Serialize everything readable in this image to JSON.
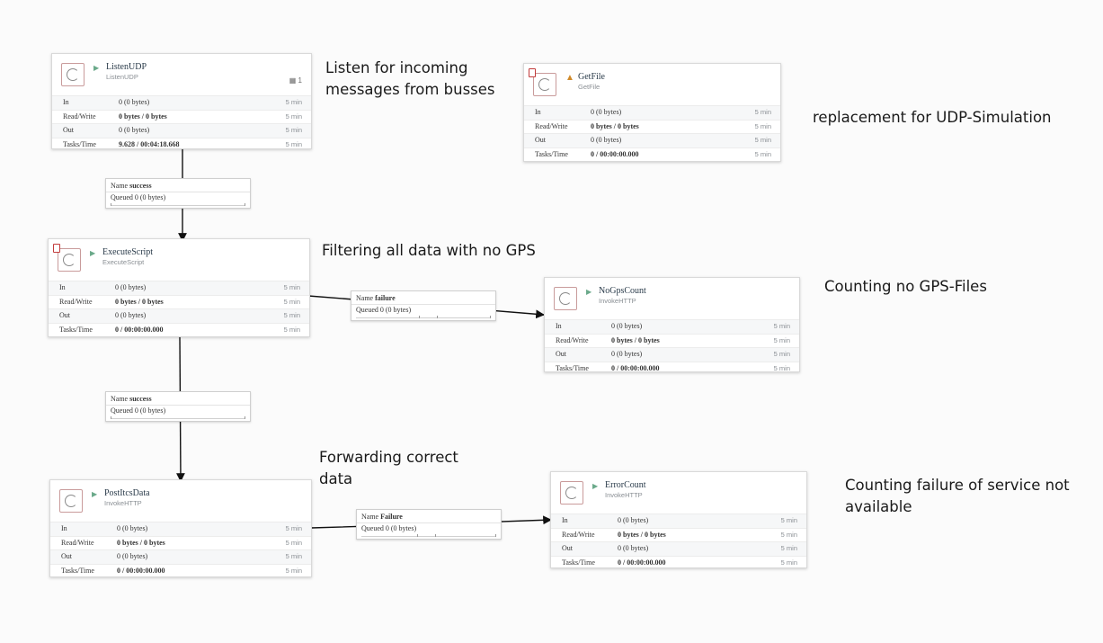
{
  "processors": [
    {
      "id": "listen-udp",
      "name": "ListenUDP",
      "type": "ListenUDP",
      "state": "run",
      "flag": false,
      "badge": "1",
      "stats": {
        "in": "0 (0 bytes)",
        "read_write": "0 bytes / 0 bytes",
        "out": "0 (0 bytes)",
        "tasks_time": "9.628 / 00:04:18.668"
      }
    },
    {
      "id": "get-file",
      "name": "GetFile",
      "type": "GetFile",
      "state": "warn",
      "flag": true,
      "badge": "",
      "stats": {
        "in": "0 (0 bytes)",
        "read_write": "0 bytes / 0 bytes",
        "out": "0 (0 bytes)",
        "tasks_time": "0 / 00:00:00.000"
      }
    },
    {
      "id": "execute-script",
      "name": "ExecuteScript",
      "type": "ExecuteScript",
      "state": "run",
      "flag": true,
      "badge": "",
      "stats": {
        "in": "0 (0 bytes)",
        "read_write": "0 bytes / 0 bytes",
        "out": "0 (0 bytes)",
        "tasks_time": "0 / 00:00:00.000"
      }
    },
    {
      "id": "no-gps-count",
      "name": "NoGpsCount",
      "type": "InvokeHTTP",
      "state": "run",
      "flag": false,
      "badge": "",
      "stats": {
        "in": "0 (0 bytes)",
        "read_write": "0 bytes / 0 bytes",
        "out": "0 (0 bytes)",
        "tasks_time": "0 / 00:00:00.000"
      }
    },
    {
      "id": "post-itcs-data",
      "name": "PostItcsData",
      "type": "InvokeHTTP",
      "state": "run",
      "flag": false,
      "badge": "",
      "stats": {
        "in": "0 (0 bytes)",
        "read_write": "0 bytes / 0 bytes",
        "out": "0 (0 bytes)",
        "tasks_time": "0 / 00:00:00.000"
      }
    },
    {
      "id": "error-count",
      "name": "ErrorCount",
      "type": "InvokeHTTP",
      "state": "run",
      "flag": false,
      "badge": "",
      "stats": {
        "in": "0 (0 bytes)",
        "read_write": "0 bytes / 0 bytes",
        "out": "0 (0 bytes)",
        "tasks_time": "0 / 00:00:00.000"
      }
    }
  ],
  "stat_labels": {
    "in": "In",
    "read_write": "Read/Write",
    "out": "Out",
    "tasks_time": "Tasks/Time",
    "window": "5 min"
  },
  "connections": [
    {
      "id": "conn-1",
      "name_label": "Name",
      "name": "success",
      "queued_label": "Queued",
      "queued": "0 (0 bytes)"
    },
    {
      "id": "conn-2",
      "name_label": "Name",
      "name": "failure",
      "queued_label": "Queued",
      "queued": "0 (0 bytes)"
    },
    {
      "id": "conn-3",
      "name_label": "Name",
      "name": "success",
      "queued_label": "Queued",
      "queued": "0 (0 bytes)"
    },
    {
      "id": "conn-4",
      "name_label": "Name",
      "name": "Failure",
      "queued_label": "Queued",
      "queued": "0 (0 bytes)"
    }
  ],
  "annotations": {
    "listen": "Listen for incoming messages from busses",
    "replacement": "replacement for UDP-Simulation",
    "filtering": "Filtering all data with no GPS",
    "counting_no_gps": "Counting no GPS-Files",
    "forwarding": "Forwarding correct data",
    "counting_failure": "Counting failure of service not available"
  },
  "colors": {
    "running": "#6aa98a",
    "warning": "#d08a2a",
    "invalid_flag": "#c23b3b",
    "wire": "#111111"
  }
}
